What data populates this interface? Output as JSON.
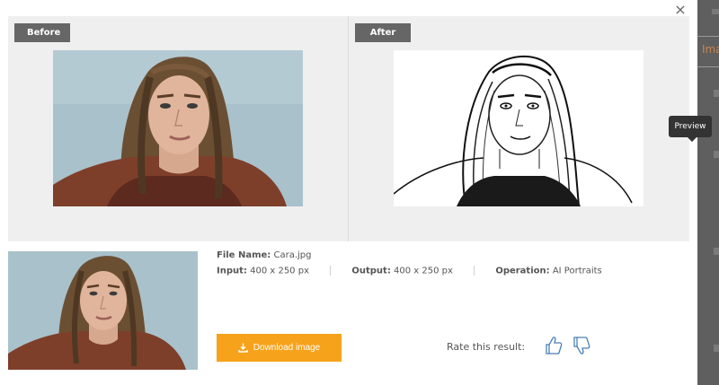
{
  "modal": {
    "close_symbol": "×",
    "before_label": "Before",
    "after_label": "After",
    "file_name_label": "File Name:",
    "file_name": "Cara.jpg",
    "input_label": "Input:",
    "input_value": "400 x 250 px",
    "output_label": "Output:",
    "output_value": "400 x 250 px",
    "operation_label": "Operation:",
    "operation_value": "AI Portraits",
    "download_label": "Download image",
    "rate_label": "Rate this result:"
  },
  "tooltip": {
    "text": "Preview"
  },
  "backdrop": {
    "fragment_text": "Ima"
  },
  "colors": {
    "accent": "#f7a21b",
    "tag_bg": "#666666",
    "panel_bg": "#efefef",
    "icon_blue": "#4a7fb5"
  },
  "icons": [
    "close-icon",
    "download-icon",
    "thumbs-up-icon",
    "thumbs-down-icon"
  ]
}
